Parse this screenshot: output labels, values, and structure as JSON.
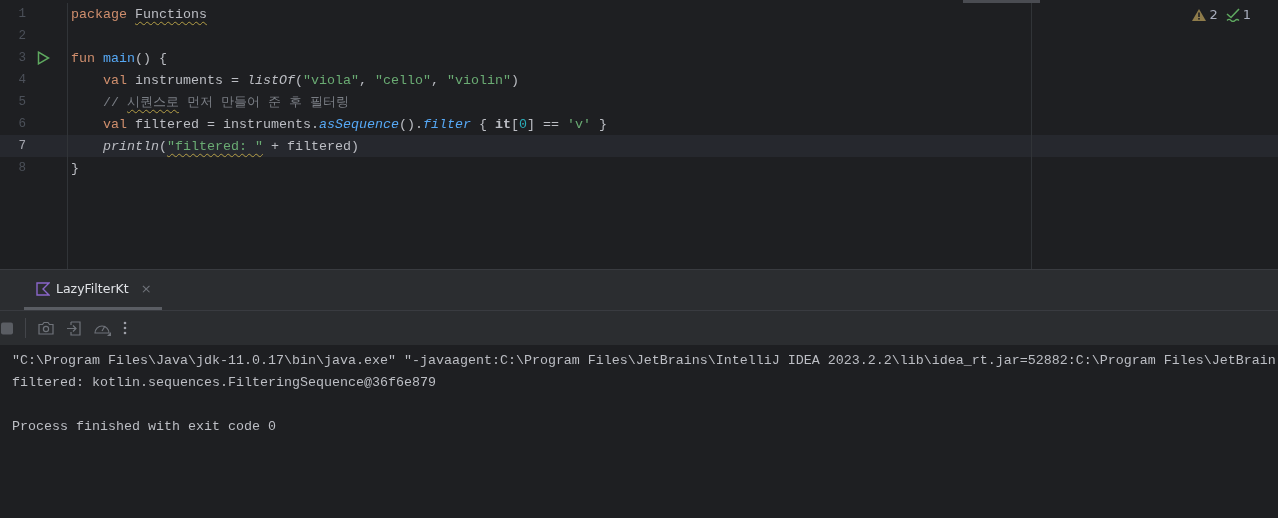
{
  "editor": {
    "inspections": {
      "warnings": "2",
      "checks": "1"
    },
    "lines": [
      {
        "number": "1",
        "current": false,
        "runnable": false,
        "tokens": [
          {
            "text": "package ",
            "kind": "keyword"
          },
          {
            "text": "Functions",
            "kind": "flagged-plain"
          }
        ]
      },
      {
        "number": "2",
        "current": false,
        "runnable": false
      },
      {
        "number": "3",
        "current": false,
        "runnable": true,
        "tokens": [
          {
            "text": "fun ",
            "kind": "keyword"
          },
          {
            "text": "main",
            "kind": "declaration"
          },
          {
            "text": "() {",
            "kind": "plain"
          }
        ]
      },
      {
        "number": "4",
        "current": false,
        "runnable": false,
        "tokens": [
          {
            "text": "    val ",
            "kind": "keyword"
          },
          {
            "text": "instruments = ",
            "kind": "plain"
          },
          {
            "text": "listOf",
            "kind": "call"
          },
          {
            "text": "(",
            "kind": "plain"
          },
          {
            "text": "\"viola\"",
            "kind": "string"
          },
          {
            "text": ", ",
            "kind": "plain"
          },
          {
            "text": "\"cello\"",
            "kind": "string"
          },
          {
            "text": ", ",
            "kind": "plain"
          },
          {
            "text": "\"violin\"",
            "kind": "string"
          },
          {
            "text": ")",
            "kind": "plain"
          }
        ]
      },
      {
        "number": "5",
        "current": false,
        "runnable": false,
        "tokens": [
          {
            "text": "    // ",
            "kind": "comment"
          },
          {
            "text": "시퀀스로",
            "kind": "flagged-comment"
          },
          {
            "text": " 먼저 만들어 준 후 필터링",
            "kind": "comment"
          }
        ]
      },
      {
        "number": "6",
        "current": false,
        "runnable": false,
        "tokens": [
          {
            "text": "    val ",
            "kind": "keyword"
          },
          {
            "text": "filtered = instruments.",
            "kind": "plain"
          },
          {
            "text": "asSequence",
            "kind": "extension-call"
          },
          {
            "text": "().",
            "kind": "plain"
          },
          {
            "text": "filter",
            "kind": "extension-call"
          },
          {
            "text": " { ",
            "kind": "plain"
          },
          {
            "text": "it",
            "kind": "bold"
          },
          {
            "text": "[",
            "kind": "plain"
          },
          {
            "text": "0",
            "kind": "number"
          },
          {
            "text": "] == ",
            "kind": "plain"
          },
          {
            "text": "'v'",
            "kind": "string"
          },
          {
            "text": " }",
            "kind": "plain"
          }
        ]
      },
      {
        "number": "7",
        "current": true,
        "runnable": false,
        "tokens": [
          {
            "text": "    println",
            "kind": "call"
          },
          {
            "text": "(",
            "kind": "plain"
          },
          {
            "text": "\"filtered: \"",
            "kind": "flagged-string"
          },
          {
            "text": " + filtered)",
            "kind": "plain"
          }
        ]
      },
      {
        "number": "8",
        "current": false,
        "runnable": false,
        "tokens": [
          {
            "text": "}",
            "kind": "plain"
          }
        ]
      }
    ]
  },
  "run_panel": {
    "tabs": [
      {
        "label": "LazyFilterKt",
        "kind": "kotlin",
        "selected": true,
        "close": "×"
      }
    ],
    "console": [
      {
        "text": "\"C:\\Program Files\\Java\\jdk-11.0.17\\bin\\java.exe\" \"-javaagent:C:\\Program Files\\JetBrains\\IntelliJ IDEA 2023.2.2\\lib\\idea_rt.jar=52882:C:\\Program Files\\JetBrain",
        "kind": "command"
      },
      {
        "text": "filtered: kotlin.sequences.FilteringSequence@36f6e879",
        "kind": "output"
      },
      {
        "text": "Process finished with exit code 0",
        "kind": "status"
      }
    ]
  }
}
